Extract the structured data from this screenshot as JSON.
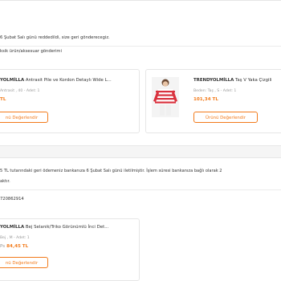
{
  "top_card": {
    "rejection_message": "6 Şubat Salı günü reddedildi, size geri gönderecegiz.",
    "reason": "ksik ürün/aksesuar gönderimi",
    "items": [
      {
        "brand": "YOLMİLLA",
        "name": "Antrasit Pile ve Kordon Detaylı Wide L...",
        "meta": "Antrasit , 40 - Adet: 1",
        "price": "TL",
        "button": "nü Değerlendir"
      },
      {
        "brand": "TRENDYOLMİLLA",
        "name": "Taş V Yaka Çizgili",
        "meta": "Beden: Taş , S - Adet: 1",
        "price": "101,34 TL",
        "button": "Ürünü Değerlendir"
      }
    ]
  },
  "bottom_card": {
    "refund_message_line1": "5 TL tutarındaki geri ödemeniz bankanıza 6 Şubat Salı günü iletilmiştir. İşlem süresi bankanıza bağlı olarak 2",
    "refund_message_line2": "aktır.",
    "reference_code": "720862914",
    "item": {
      "brand": "YOLMİLLA",
      "name": "Bej Selanik/Triko Görünümlü İnci Det...",
      "meta": "Bej , M - Adet: 1",
      "price_prefix": "Ps",
      "price": "84,45 TL",
      "button": "nü Değerlendir"
    }
  },
  "colors": {
    "accent": "#f27a1a",
    "stripe": "#d9323e"
  }
}
